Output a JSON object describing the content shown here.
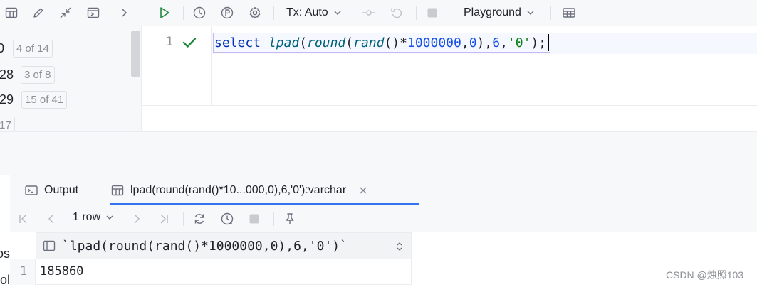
{
  "left_panel": {
    "rows": [
      {
        "num": "0",
        "badge": "4 of 14"
      },
      {
        "num": "28",
        "badge": "3 of 8"
      },
      {
        "num": "29",
        "badge": "15 of 41"
      },
      {
        "num": "",
        "badge": "17"
      }
    ]
  },
  "toolbar": {
    "tx_label": "Tx: Auto",
    "playground_label": "Playground"
  },
  "editor": {
    "line_number": "1",
    "code_keyword": "select",
    "code_fn_lpad": "lpad",
    "code_fn_round": "round",
    "code_fn_rand": "rand",
    "code_num_1": "1000000",
    "code_num_2": "0",
    "code_num_3": "6",
    "code_str": "'0'"
  },
  "results": {
    "tabs": [
      {
        "label": "Output"
      },
      {
        "label": "lpad(round(rand()*10...000,0),6,'0'):varchar"
      }
    ],
    "rows_label": "1 row",
    "column_header": "`lpad(round(rand()*1000000,0),6,'0')`",
    "row_number": "1",
    "cell_value": "185860"
  },
  "left_stub": {
    "line1": "os",
    "line2": "ol"
  },
  "watermark": "CSDN @烛照103",
  "colors": {
    "accent": "#3574f0",
    "run_green": "#208a3c",
    "keyword": "#0033b3",
    "function": "#00627a",
    "number": "#1750eb",
    "string": "#067d17"
  }
}
